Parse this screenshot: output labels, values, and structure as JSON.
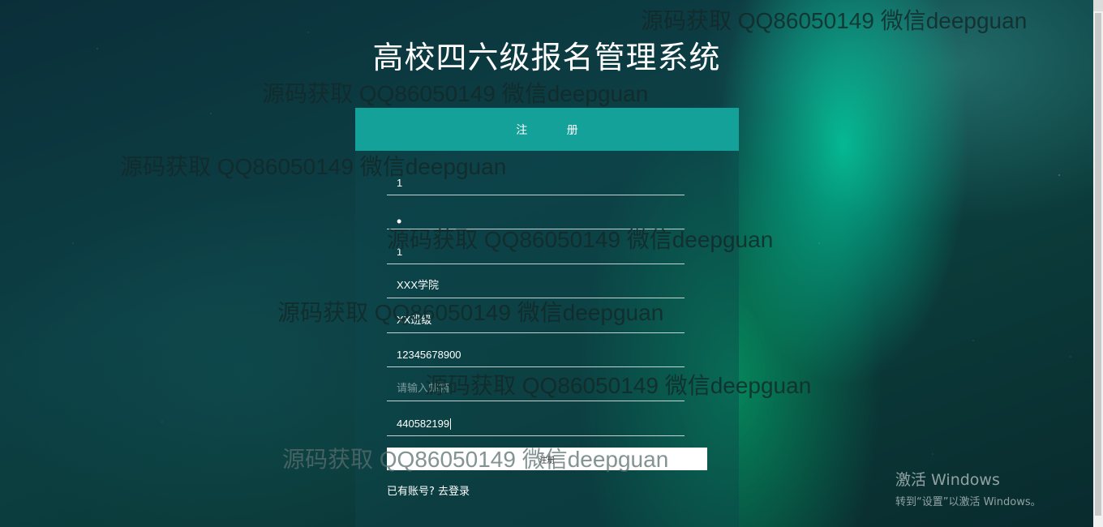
{
  "title": "高校四六级报名管理系统",
  "panel": {
    "header": "注 册"
  },
  "fields": [
    {
      "value": "1",
      "placeholder": ""
    },
    {
      "value": "•",
      "placeholder": ""
    },
    {
      "value": "1",
      "placeholder": ""
    },
    {
      "value": "XXX学院",
      "placeholder": ""
    },
    {
      "value": "XX班级",
      "placeholder": ""
    },
    {
      "value": "12345678900",
      "placeholder": ""
    },
    {
      "value": "",
      "placeholder": "请输入邮箱"
    },
    {
      "value": "440582199",
      "placeholder": ""
    }
  ],
  "submit_label": "注册",
  "login_link": "已有账号? 去登录",
  "watermark_text": "源码获取 QQ86050149 微信deepguan",
  "activation": {
    "line1": "激活 Windows",
    "line2": "转到“设置”以激活 Windows。"
  },
  "colors": {
    "header_bg": "#13a19a",
    "panel_bg": "rgba(14,70,78,0.45)"
  }
}
